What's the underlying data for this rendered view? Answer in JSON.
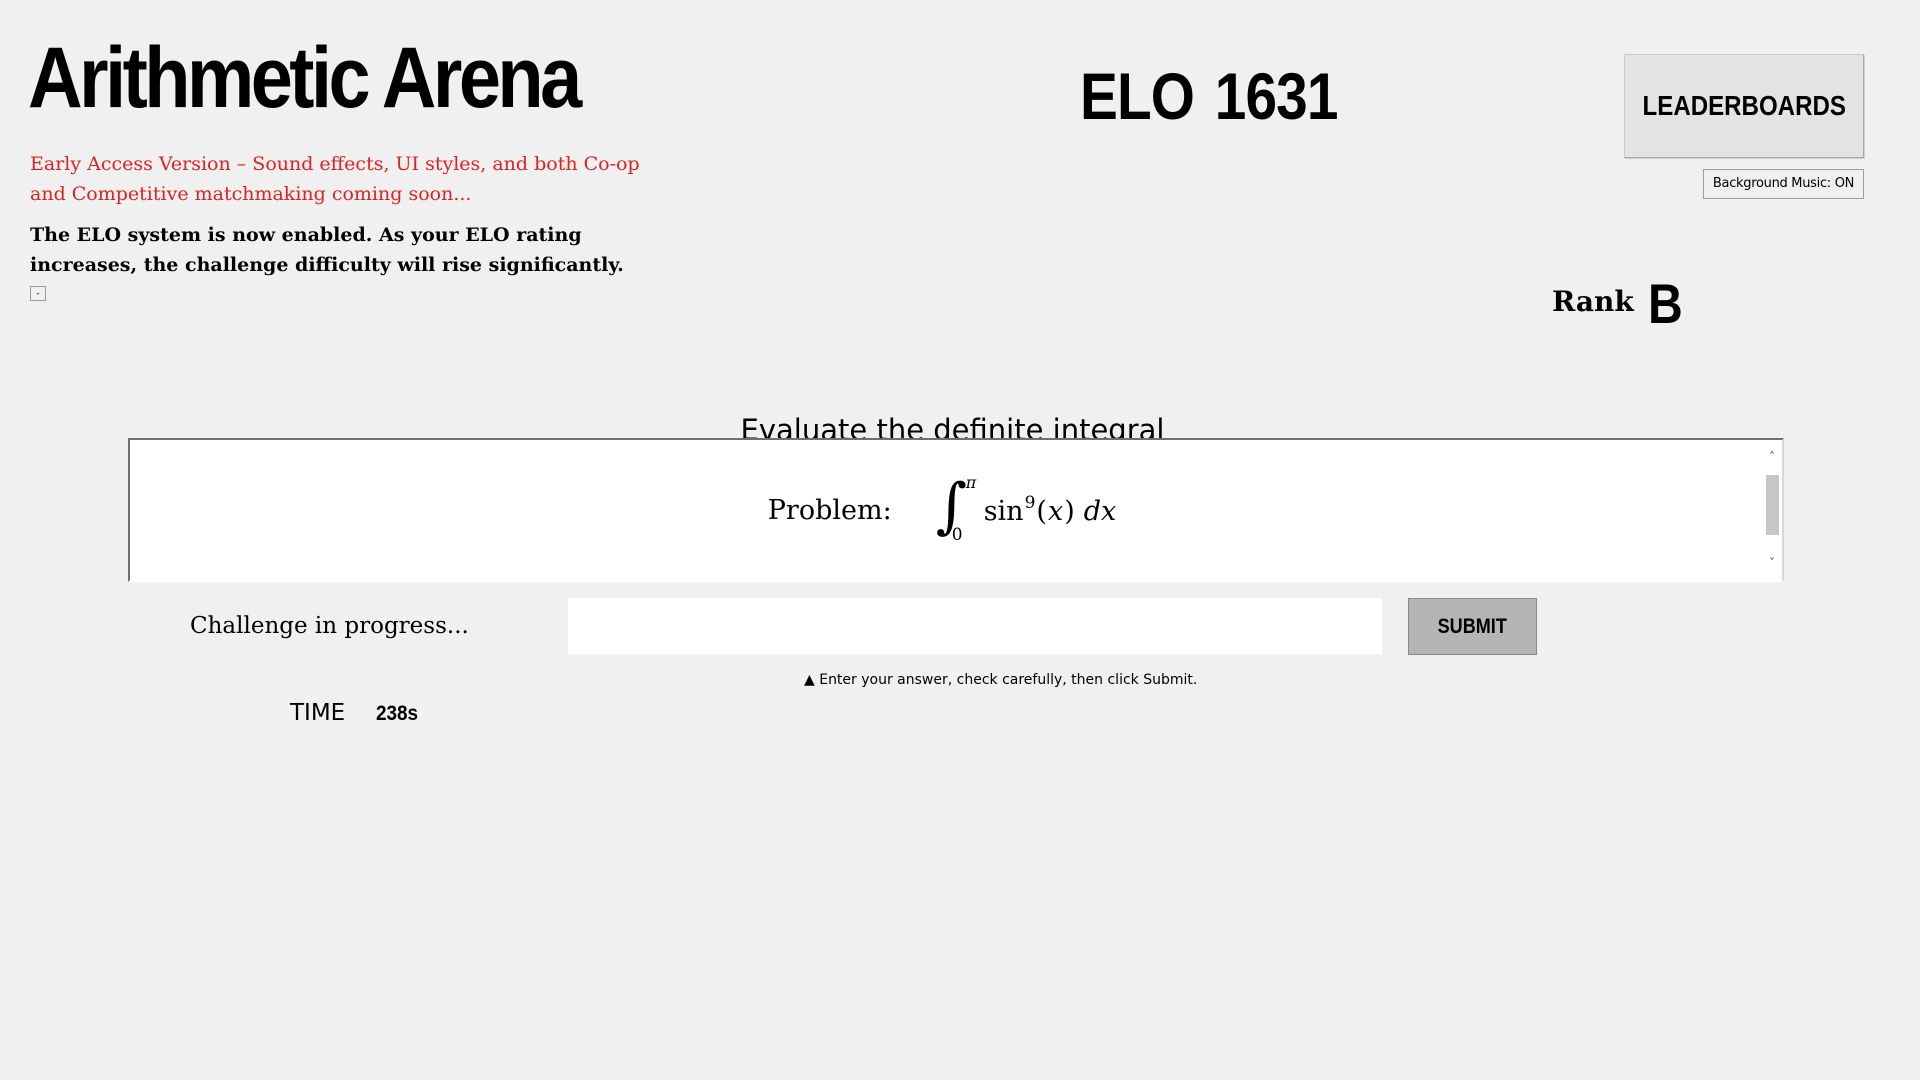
{
  "header": {
    "app_title": "Arithmetic Arena",
    "notice_early_access": "Early Access Version – Sound effects, UI styles, and both Co-op and Competitive matchmaking coming soon...",
    "notice_elo": "The ELO system is now enabled. As your ELO rating increases, the challenge difficulty will rise significantly.",
    "collapse_label": "-"
  },
  "elo": {
    "label": "ELO",
    "value": "1631"
  },
  "controls": {
    "leaderboards_label": "LEADERBOARDS",
    "music_label": "Background Music: ON"
  },
  "rank": {
    "label": "Rank",
    "value": "B"
  },
  "problem": {
    "heading": "Evaluate the definite integral",
    "label": "Problem:",
    "integral_sign": "∫",
    "upper_limit": "π",
    "lower_limit": "0",
    "function": "sin",
    "exponent": "9",
    "open_paren": "(",
    "variable": "x",
    "close_paren": ")",
    "differential": "dx",
    "scroll_up_icon": "˄",
    "scroll_down_icon": "˅"
  },
  "challenge": {
    "status": "Challenge in progress...",
    "answer_value": "",
    "submit_label": "SUBMIT",
    "hint": "▲ Enter your answer, check carefully, then click Submit.",
    "time_label": "TIME",
    "time_value": "238s"
  }
}
